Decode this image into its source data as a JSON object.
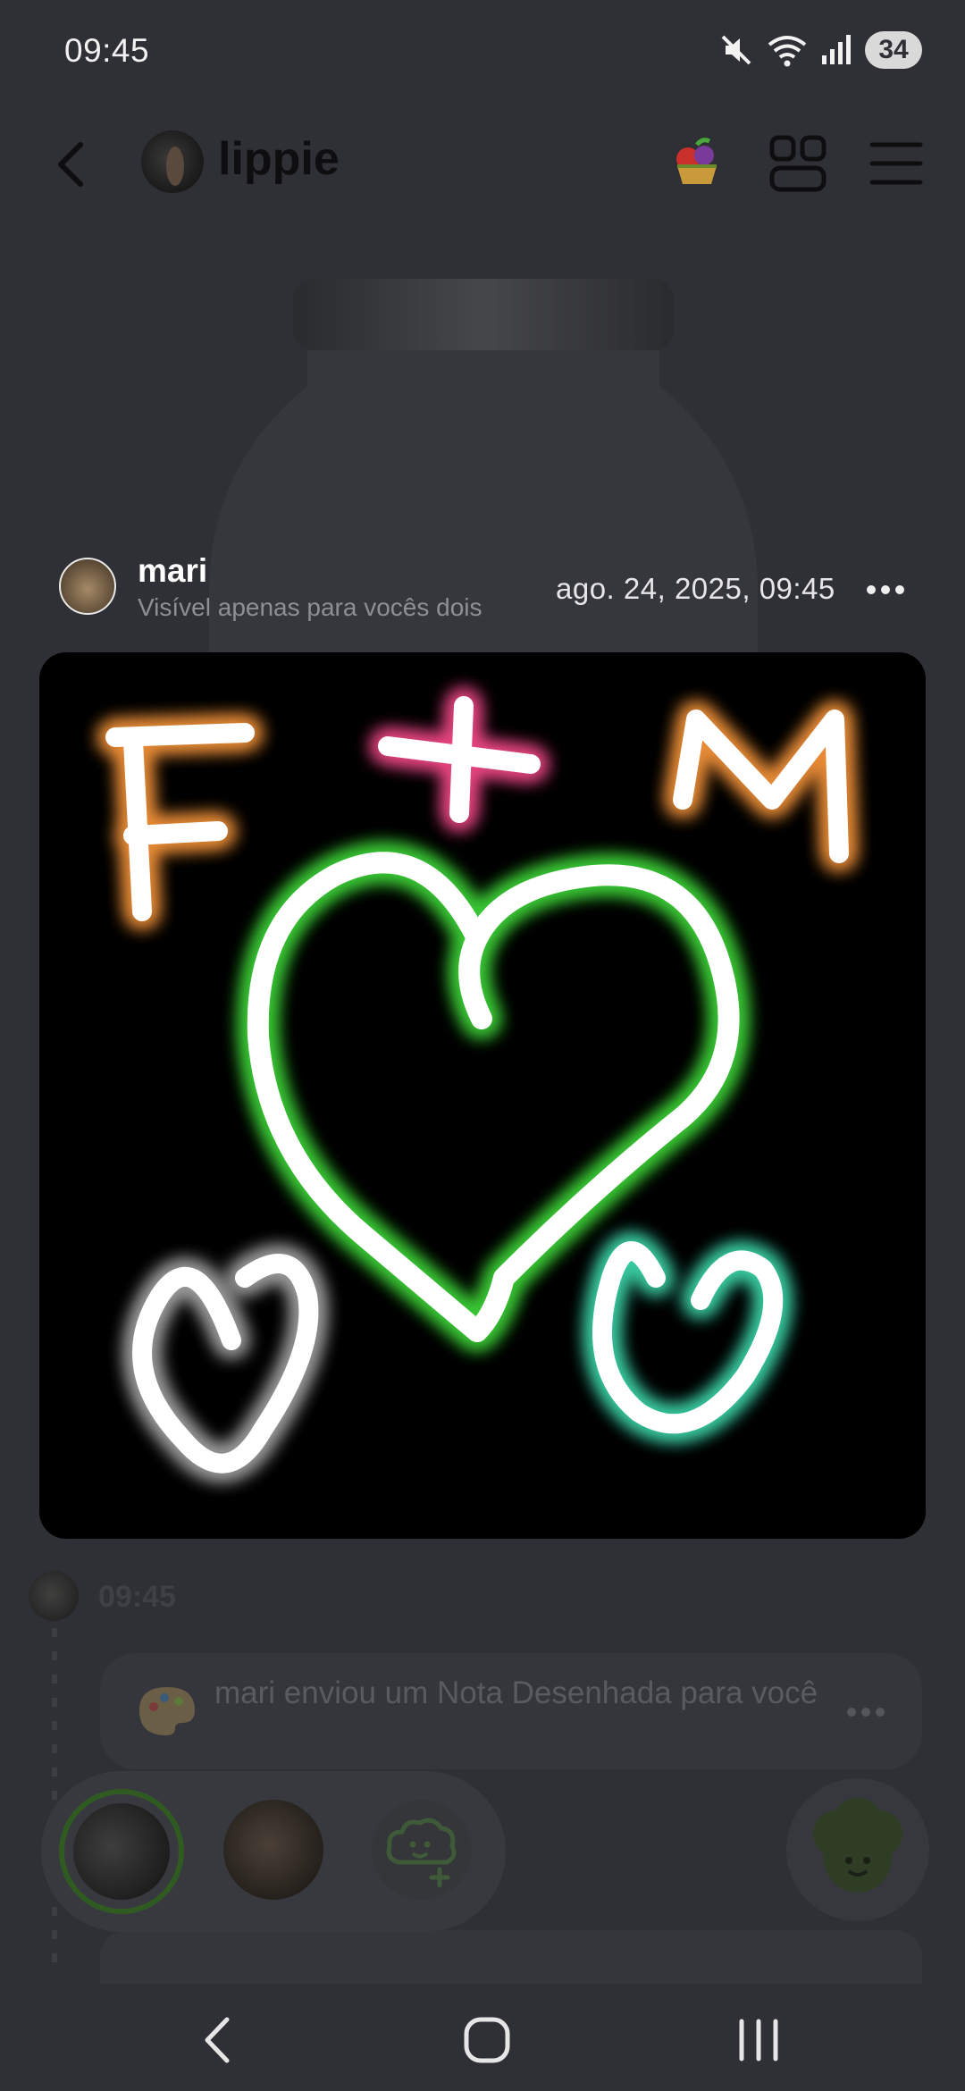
{
  "status_bar": {
    "time": "09:45",
    "battery": "34",
    "icons": [
      "mute-icon",
      "wifi-icon",
      "signal-icon",
      "battery-icon"
    ]
  },
  "header": {
    "title": "lippie",
    "icons": [
      "back-icon",
      "avatar",
      "fruit-basket-icon",
      "grid-icon",
      "menu-icon"
    ]
  },
  "note": {
    "author": "mari",
    "visibility": "Visível apenas para vocês dois",
    "date": "ago. 24, 2025, 09:45",
    "drawing_text": [
      "F",
      "+",
      "M"
    ],
    "colors": {
      "orange_glow": "#ff9a3c",
      "pink_glow": "#ff4d8d",
      "green_glow": "#3fdc3a",
      "teal_glow": "#3fe0b0",
      "stroke": "#ffffff"
    }
  },
  "chat": {
    "time": "09:45",
    "message": "mari enviou um Nota Desenhada para você"
  },
  "colors": {
    "background": "#2f3035",
    "title": "#0e0e10",
    "ring": "#2f5a22"
  }
}
